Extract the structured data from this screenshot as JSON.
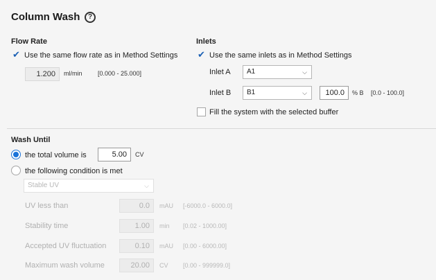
{
  "header": {
    "title": "Column Wash",
    "help_icon": "?"
  },
  "flow_rate": {
    "heading": "Flow Rate",
    "same_checkbox_label": "Use the same flow rate as in Method Settings",
    "same_checked": true,
    "value": "1.200",
    "unit": "ml/min",
    "range": "[0.000 - 25.000]"
  },
  "inlets": {
    "heading": "Inlets",
    "same_checkbox_label": "Use the same inlets as in Method Settings",
    "same_checked": true,
    "inlet_a_label": "Inlet A",
    "inlet_a_value": "A1",
    "inlet_b_label": "Inlet B",
    "inlet_b_value": "B1",
    "percent_b_value": "100.0",
    "percent_b_unit": "% B",
    "percent_b_range": "[0.0 - 100.0]",
    "fill_label": "Fill the system with the selected buffer",
    "fill_checked": false
  },
  "wash_until": {
    "heading": "Wash Until",
    "option_total_label": "the total volume is",
    "option_total_selected": true,
    "total_value": "5.00",
    "total_unit": "CV",
    "option_condition_label": "the following condition is met",
    "condition_select": "Stable UV",
    "params": [
      {
        "label": "UV less than",
        "value": "0.0",
        "unit": "mAU",
        "range": "[-6000.0 - 6000.0]"
      },
      {
        "label": "Stability time",
        "value": "1.00",
        "unit": "min",
        "range": "[0.02 - 1000.00]"
      },
      {
        "label": "Accepted UV fluctuation",
        "value": "0.10",
        "unit": "mAU",
        "range": "[0.00 - 6000.00]"
      },
      {
        "label": "Maximum wash volume",
        "value": "20.00",
        "unit": "CV",
        "range": "[0.00 - 999999.0]"
      }
    ]
  },
  "colors": {
    "accent": "#1a73d9",
    "background": "#f5f5f5"
  }
}
